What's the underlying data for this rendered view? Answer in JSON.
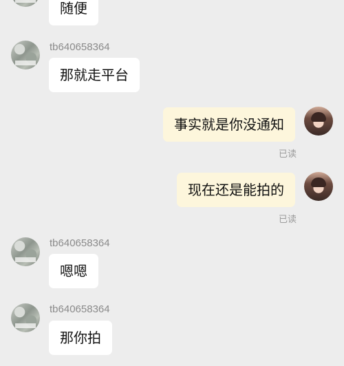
{
  "messages": [
    {
      "side": "other",
      "text": "随便"
    },
    {
      "side": "other",
      "username": "tb640658364",
      "text": "那就走平台"
    },
    {
      "side": "me",
      "text": "事实就是你没通知",
      "status": "已读"
    },
    {
      "side": "me",
      "text": "现在还是能拍的",
      "status": "已读"
    },
    {
      "side": "other",
      "username": "tb640658364",
      "text": "嗯嗯"
    },
    {
      "side": "other",
      "username": "tb640658364",
      "text": "那你拍"
    }
  ],
  "colors": {
    "background": "#ededed",
    "bubble_other": "#ffffff",
    "bubble_me": "#fdf6dc",
    "username": "#8a8a8a",
    "read_status": "#9b9b9b"
  }
}
